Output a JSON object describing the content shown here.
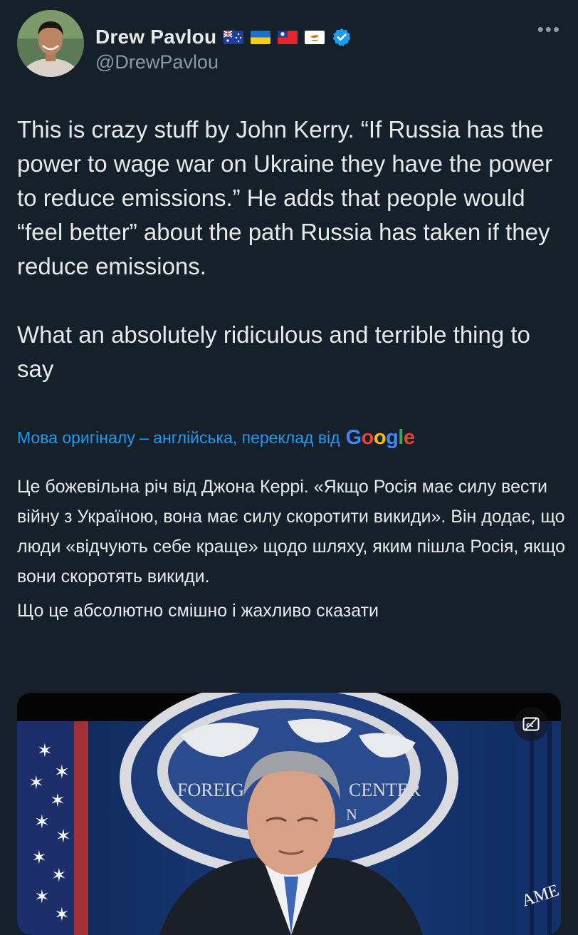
{
  "author": {
    "name": "Drew Pavlou",
    "handle": "@DrewPavlou",
    "flags": [
      "australia-flag",
      "ukraine-flag",
      "taiwan-flag",
      "cyprus-flag"
    ],
    "verified": true
  },
  "tweet": {
    "text": "This is crazy stuff by John Kerry. “If Russia has the power to wage war on Ukraine they have the power to reduce emissions.” He adds that people would “feel better” about the path Russia has taken if they reduce emissions.\n\nWhat an absolutely ridiculous and terrible thing to say"
  },
  "translation": {
    "label": "Мова оригіналу – англійська, переклад від",
    "provider": "Google",
    "paragraphs": [
      "Це божевільна річ від Джона Керрі. «Якщо Росія має силу вести війну з Україною, вона має силу скоротити викиди». Він додає, що люди «відчують себе краще» щодо шляху, яким пішла Росія, якщо вони скоротять викиди.",
      "Що це абсолютно смішно і жахливо сказати"
    ]
  },
  "media": {
    "sign_left": "FOREIG",
    "sign_right": "CENTER",
    "sign_sub": "N",
    "badge_fragment": "AME",
    "cc_icon": "closed-captions-icon"
  },
  "colors": {
    "background": "#15202b",
    "text": "#e7e9ea",
    "secondary": "#8b98a5",
    "accent": "#1d9bf0"
  }
}
